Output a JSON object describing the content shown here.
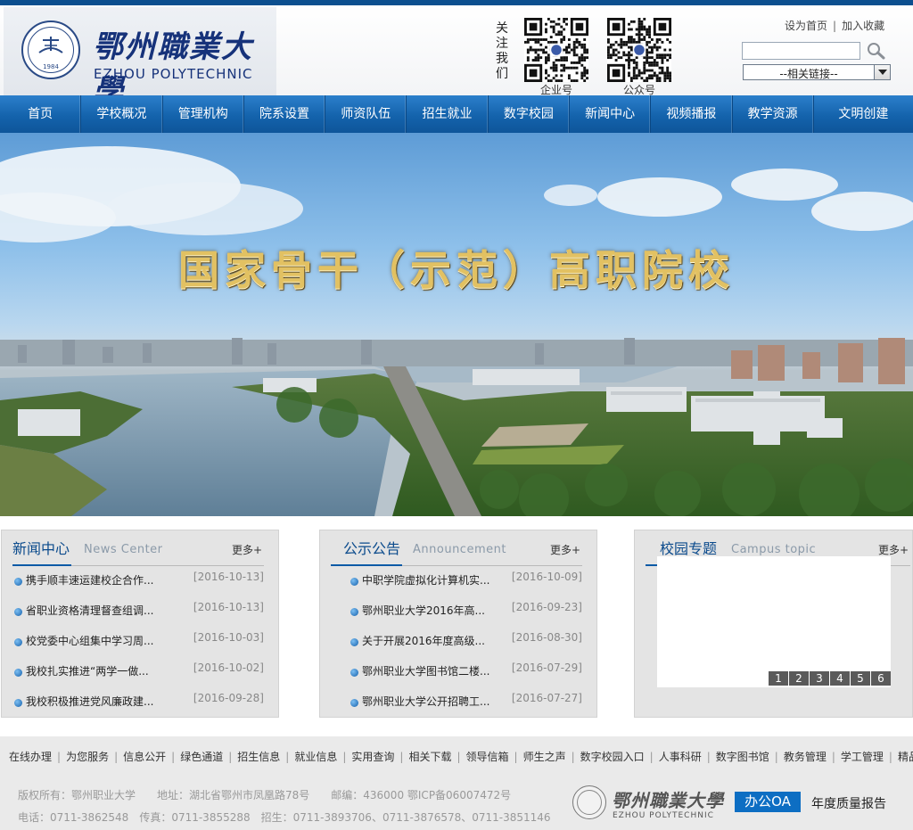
{
  "header": {
    "logo_cn": "鄂州職業大學",
    "logo_en": "EZHOU POLYTECHNIC",
    "seal_year": "1984",
    "follow_text": "关注我们",
    "qr_codes": [
      {
        "label": "企业号"
      },
      {
        "label": "公众号"
      }
    ],
    "top_links": [
      "设为首页",
      "加入收藏"
    ],
    "search": {
      "value": "",
      "icon": "magnifier-icon"
    },
    "select": {
      "value": "--相关链接--"
    }
  },
  "nav": {
    "items": [
      "首页",
      "学校概况",
      "管理机构",
      "院系设置",
      "师资队伍",
      "招生就业",
      "数字校园",
      "新闻中心",
      "视频播报",
      "教学资源",
      "文明创建"
    ]
  },
  "banner": {
    "slogan": "国家骨干（示范）高职院校"
  },
  "panels": {
    "news": {
      "title": "新闻中心",
      "subtitle": "News Center",
      "more": "更多+",
      "items": [
        {
          "title": "携手顺丰速运建校企合作...",
          "date": "[2016-10-13]"
        },
        {
          "title": "省职业资格清理督查组调...",
          "date": "[2016-10-13]"
        },
        {
          "title": "校党委中心组集中学习周...",
          "date": "[2016-10-03]"
        },
        {
          "title": "我校扎实推进“两学一做...",
          "date": "[2016-10-02]"
        },
        {
          "title": "我校积极推进党风廉政建...",
          "date": "[2016-09-28]"
        }
      ]
    },
    "notice": {
      "title": "公示公告",
      "subtitle": "Announcement",
      "more": "更多+",
      "items": [
        {
          "title": "中职学院虚拟化计算机实...",
          "date": "[2016-10-09]"
        },
        {
          "title": "鄂州职业大学2016年高...",
          "date": "[2016-09-23]"
        },
        {
          "title": "关于开展2016年度高级...",
          "date": "[2016-08-30]"
        },
        {
          "title": "鄂州职业大学图书馆二楼...",
          "date": "[2016-07-29]"
        },
        {
          "title": "鄂州职业大学公开招聘工...",
          "date": "[2016-07-27]"
        }
      ]
    },
    "topic": {
      "title": "校园专题",
      "subtitle": "Campus topic",
      "more": "更多+",
      "pages": [
        "1",
        "2",
        "3",
        "4",
        "5",
        "6"
      ]
    }
  },
  "quicklinks": [
    "在线办理",
    "为您服务",
    "信息公开",
    "绿色通道",
    "招生信息",
    "就业信息",
    "实用查询",
    "相关下载",
    "领导信箱",
    "师生之声",
    "数字校园入口",
    "人事科研",
    "数字图书馆",
    "教务管理",
    "学工管理",
    "精品课程"
  ],
  "footer": {
    "line1": "版权所有：鄂州职业大学　　地址：湖北省鄂州市凤凰路78号　　邮编：436000 鄂ICP备06007472号",
    "line2": "电话：0711-3862548　传真：0711-3855288　招生：0711-3893706、0711-3876578、0711-3851146",
    "logo_cn": "鄂州職業大學",
    "logo_en": "EZHOU POLYTECHNIC",
    "oa_label": "办公OA",
    "report_label": "年度质量报告"
  },
  "colors": {
    "nav_blue": "#1463ac",
    "header_bar": "#0c4f8f",
    "oa_blue": "#0d6ec3",
    "title_blue": "#0a4a8c"
  }
}
